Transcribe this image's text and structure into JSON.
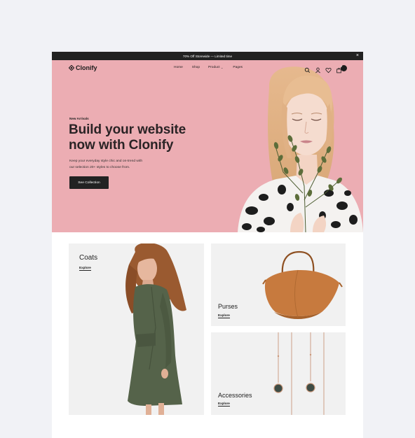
{
  "announcement": {
    "text": "70% Off Storewide — Limited time",
    "close": "×"
  },
  "brand": {
    "name": "Clonify"
  },
  "nav": {
    "items": [
      {
        "label": "Home"
      },
      {
        "label": "Shop"
      },
      {
        "label": "Product"
      },
      {
        "label": "Pages"
      }
    ],
    "product_caret": "⌄",
    "cart_count": "0"
  },
  "hero": {
    "eyebrow": "New Arrivals",
    "headline_line1": "Build your website",
    "headline_line2": "now with Clonify",
    "sub_line1": "Keep your everyday style chic and on-trend with",
    "sub_line2": "our selection 20+ styles to choose from.",
    "cta": "See Collection"
  },
  "collections": [
    {
      "title": "Coats",
      "link": "Explore"
    },
    {
      "title": "Purses",
      "link": "Explore"
    },
    {
      "title": "Accessories",
      "link": "Explore"
    }
  ],
  "colors": {
    "hero_bg": "#ecadb3",
    "dark": "#222222",
    "tile_bg": "#f1f1f1"
  }
}
